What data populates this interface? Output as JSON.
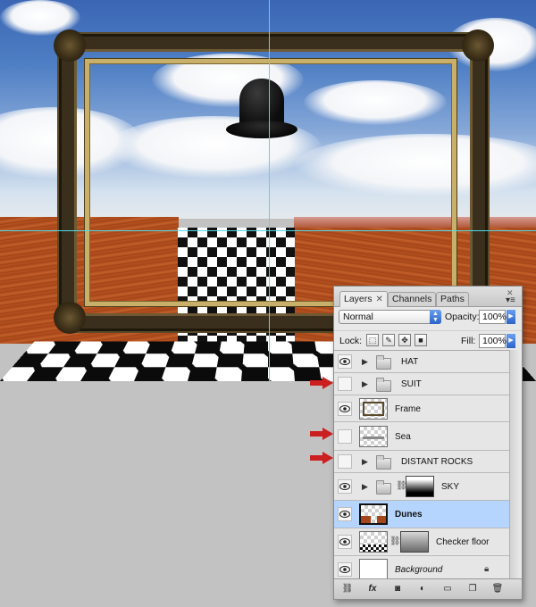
{
  "canvas": {
    "description_colors": {
      "sky": "#4f7fc4",
      "desert": "#b8531f",
      "guide": "#4fd9e8"
    }
  },
  "layers_panel": {
    "tabs": [
      {
        "label": "Layers",
        "active": true
      },
      {
        "label": "Channels",
        "active": false
      },
      {
        "label": "Paths",
        "active": false
      }
    ],
    "blend_mode": "Normal",
    "opacity_label": "Opacity:",
    "opacity_value": "100%",
    "lock_label": "Lock:",
    "fill_label": "Fill:",
    "fill_value": "100%",
    "layers": [
      {
        "name": "HAT",
        "type": "group",
        "visible": true,
        "selected": false
      },
      {
        "name": "SUIT",
        "type": "group",
        "visible": false,
        "selected": false,
        "marked": true
      },
      {
        "name": "Frame",
        "type": "layer",
        "visible": true,
        "selected": false
      },
      {
        "name": "Sea",
        "type": "layer",
        "visible": false,
        "selected": false,
        "marked": true
      },
      {
        "name": "DISTANT ROCKS",
        "type": "group",
        "visible": false,
        "selected": false,
        "marked": true
      },
      {
        "name": "SKY",
        "type": "group-masked",
        "visible": true,
        "selected": false
      },
      {
        "name": "Dunes",
        "type": "layer",
        "visible": true,
        "selected": true
      },
      {
        "name": "Checker floor",
        "type": "layer-masked",
        "visible": true,
        "selected": false
      },
      {
        "name": "Background",
        "type": "background",
        "visible": true,
        "selected": false,
        "locked": true
      }
    ],
    "footer_icons": [
      "link-icon",
      "fx-icon",
      "add-mask-icon",
      "adjustment-layer-icon",
      "new-group-icon",
      "new-layer-icon",
      "trash-icon"
    ],
    "footer_fx_label": "fx"
  },
  "annotation_arrow_color": "#cc1f1f"
}
